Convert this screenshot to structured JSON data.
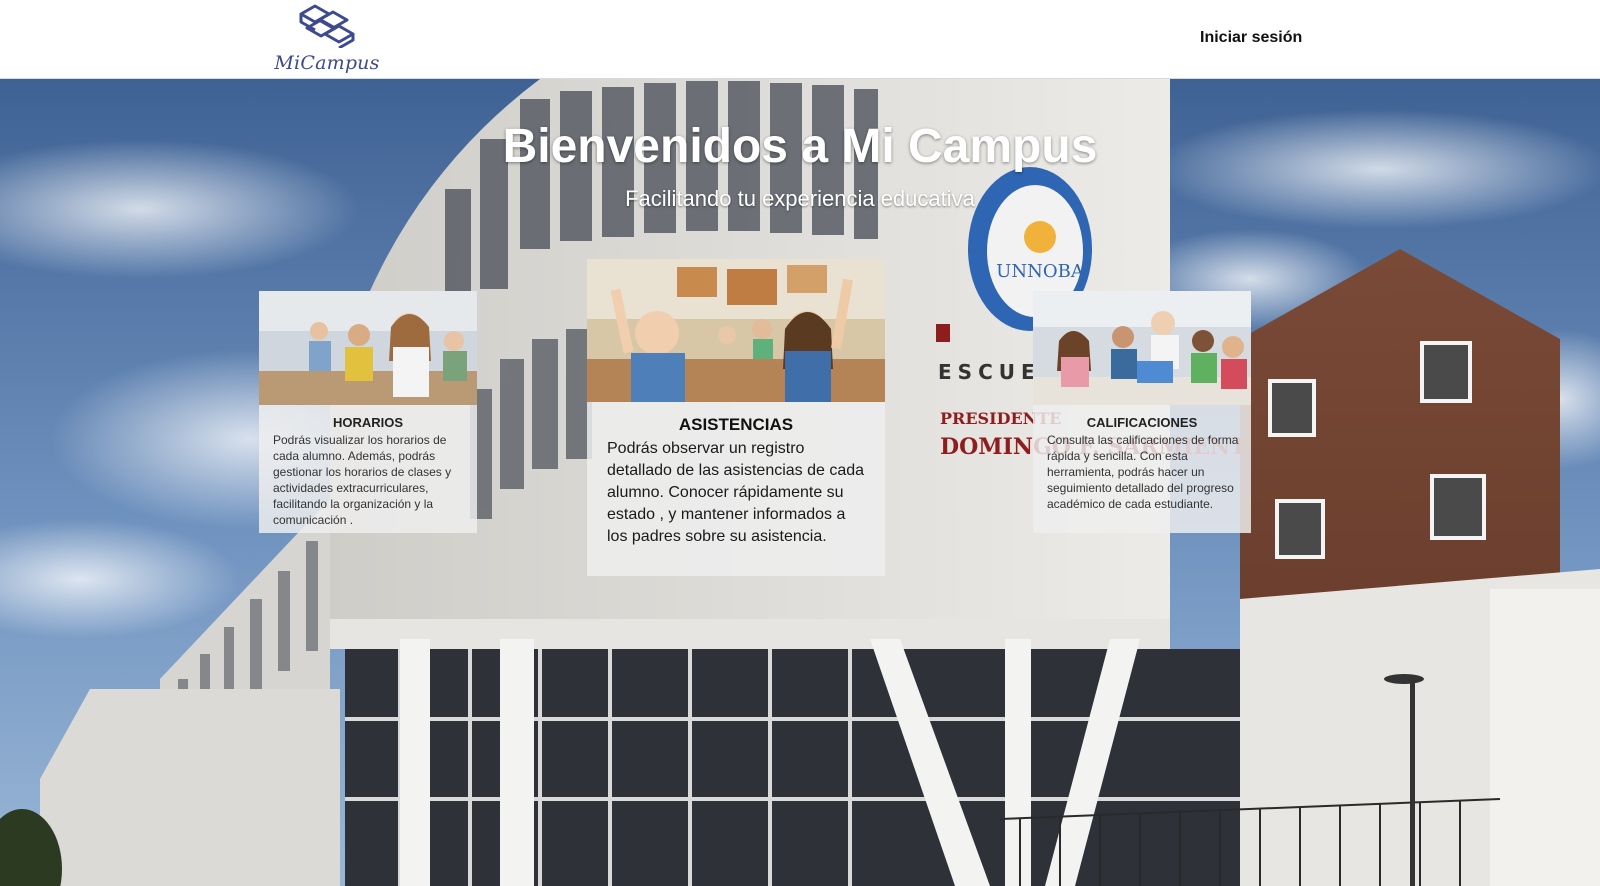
{
  "header": {
    "logo_text": "MiCampus",
    "login_label": "Iniciar sesión"
  },
  "hero": {
    "title": "Bienvenidos a Mi Campus",
    "subtitle": "Facilitando tu experiencia educativa"
  },
  "cards": [
    {
      "title": "HORARIOS",
      "text": "Podrás visualizar los horarios de cada alumno. Además, podrás gestionar los horarios de clases y actividades extracurriculares, facilitando la organización y la comunicación ."
    },
    {
      "title": "ASISTENCIAS",
      "text": "Podrás observar un registro detallado de las asistencias de cada alumno. Conocer rápidamente su estado , y mantener informados a los padres sobre su asistencia."
    },
    {
      "title": "CALIFICACIONES",
      "text": "Consulta las calificaciones de forma rápida y sencilla. Con esta herramienta, podrás hacer un seguimiento detallado del progreso académico de cada estudiante."
    }
  ],
  "building_sign": {
    "seal_text": "UNNOBA",
    "line1": "ESCUELA SECUNDARIA",
    "line2": "PRESIDENTE",
    "line3": "DOMINGO F. SARMIENTO"
  },
  "colors": {
    "brand": "#3d4a8f",
    "sky_top": "#3f6294",
    "sky_bottom": "#8fb0d4",
    "card_bg": "#eeeeee"
  }
}
